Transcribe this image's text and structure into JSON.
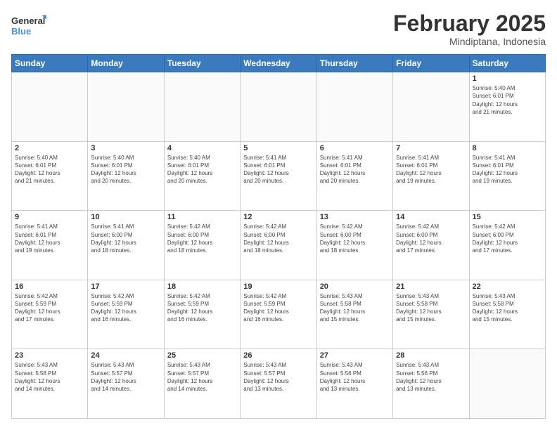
{
  "header": {
    "logo_line1": "General",
    "logo_line2": "Blue",
    "month_year": "February 2025",
    "location": "Mindiptana, Indonesia"
  },
  "days_of_week": [
    "Sunday",
    "Monday",
    "Tuesday",
    "Wednesday",
    "Thursday",
    "Friday",
    "Saturday"
  ],
  "weeks": [
    [
      {
        "day": "",
        "info": ""
      },
      {
        "day": "",
        "info": ""
      },
      {
        "day": "",
        "info": ""
      },
      {
        "day": "",
        "info": ""
      },
      {
        "day": "",
        "info": ""
      },
      {
        "day": "",
        "info": ""
      },
      {
        "day": "1",
        "info": "Sunrise: 5:40 AM\nSunset: 6:01 PM\nDaylight: 12 hours\nand 21 minutes."
      }
    ],
    [
      {
        "day": "2",
        "info": "Sunrise: 5:40 AM\nSunset: 6:01 PM\nDaylight: 12 hours\nand 21 minutes."
      },
      {
        "day": "3",
        "info": "Sunrise: 5:40 AM\nSunset: 6:01 PM\nDaylight: 12 hours\nand 20 minutes."
      },
      {
        "day": "4",
        "info": "Sunrise: 5:40 AM\nSunset: 6:01 PM\nDaylight: 12 hours\nand 20 minutes."
      },
      {
        "day": "5",
        "info": "Sunrise: 5:41 AM\nSunset: 6:01 PM\nDaylight: 12 hours\nand 20 minutes."
      },
      {
        "day": "6",
        "info": "Sunrise: 5:41 AM\nSunset: 6:01 PM\nDaylight: 12 hours\nand 20 minutes."
      },
      {
        "day": "7",
        "info": "Sunrise: 5:41 AM\nSunset: 6:01 PM\nDaylight: 12 hours\nand 19 minutes."
      },
      {
        "day": "8",
        "info": "Sunrise: 5:41 AM\nSunset: 6:01 PM\nDaylight: 12 hours\nand 19 minutes."
      }
    ],
    [
      {
        "day": "9",
        "info": "Sunrise: 5:41 AM\nSunset: 6:01 PM\nDaylight: 12 hours\nand 19 minutes."
      },
      {
        "day": "10",
        "info": "Sunrise: 5:41 AM\nSunset: 6:00 PM\nDaylight: 12 hours\nand 18 minutes."
      },
      {
        "day": "11",
        "info": "Sunrise: 5:42 AM\nSunset: 6:00 PM\nDaylight: 12 hours\nand 18 minutes."
      },
      {
        "day": "12",
        "info": "Sunrise: 5:42 AM\nSunset: 6:00 PM\nDaylight: 12 hours\nand 18 minutes."
      },
      {
        "day": "13",
        "info": "Sunrise: 5:42 AM\nSunset: 6:00 PM\nDaylight: 12 hours\nand 18 minutes."
      },
      {
        "day": "14",
        "info": "Sunrise: 5:42 AM\nSunset: 6:00 PM\nDaylight: 12 hours\nand 17 minutes."
      },
      {
        "day": "15",
        "info": "Sunrise: 5:42 AM\nSunset: 6:00 PM\nDaylight: 12 hours\nand 17 minutes."
      }
    ],
    [
      {
        "day": "16",
        "info": "Sunrise: 5:42 AM\nSunset: 5:59 PM\nDaylight: 12 hours\nand 17 minutes."
      },
      {
        "day": "17",
        "info": "Sunrise: 5:42 AM\nSunset: 5:59 PM\nDaylight: 12 hours\nand 16 minutes."
      },
      {
        "day": "18",
        "info": "Sunrise: 5:42 AM\nSunset: 5:59 PM\nDaylight: 12 hours\nand 16 minutes."
      },
      {
        "day": "19",
        "info": "Sunrise: 5:42 AM\nSunset: 5:59 PM\nDaylight: 12 hours\nand 16 minutes."
      },
      {
        "day": "20",
        "info": "Sunrise: 5:43 AM\nSunset: 5:58 PM\nDaylight: 12 hours\nand 15 minutes."
      },
      {
        "day": "21",
        "info": "Sunrise: 5:43 AM\nSunset: 5:58 PM\nDaylight: 12 hours\nand 15 minutes."
      },
      {
        "day": "22",
        "info": "Sunrise: 5:43 AM\nSunset: 5:58 PM\nDaylight: 12 hours\nand 15 minutes."
      }
    ],
    [
      {
        "day": "23",
        "info": "Sunrise: 5:43 AM\nSunset: 5:58 PM\nDaylight: 12 hours\nand 14 minutes."
      },
      {
        "day": "24",
        "info": "Sunrise: 5:43 AM\nSunset: 5:57 PM\nDaylight: 12 hours\nand 14 minutes."
      },
      {
        "day": "25",
        "info": "Sunrise: 5:43 AM\nSunset: 5:57 PM\nDaylight: 12 hours\nand 14 minutes."
      },
      {
        "day": "26",
        "info": "Sunrise: 5:43 AM\nSunset: 5:57 PM\nDaylight: 12 hours\nand 13 minutes."
      },
      {
        "day": "27",
        "info": "Sunrise: 5:43 AM\nSunset: 5:56 PM\nDaylight: 12 hours\nand 13 minutes."
      },
      {
        "day": "28",
        "info": "Sunrise: 5:43 AM\nSunset: 5:56 PM\nDaylight: 12 hours\nand 13 minutes."
      },
      {
        "day": "",
        "info": ""
      }
    ]
  ]
}
